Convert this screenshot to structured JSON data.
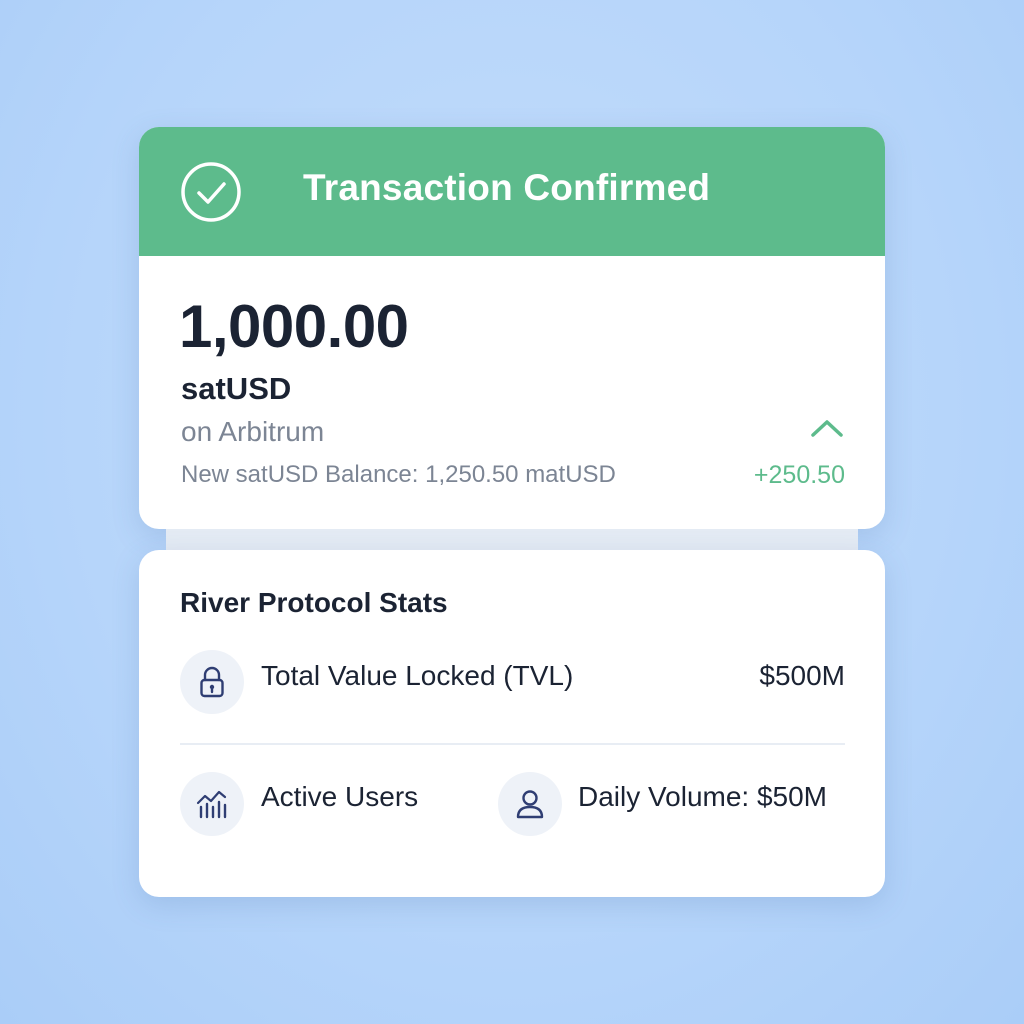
{
  "confirmation": {
    "title": "Transaction Confirmed",
    "amount": "1,000.00",
    "token": "satUSD",
    "network": "on Arbitrum",
    "new_balance": "New satUSD Balance: 1,250.50 matUSD",
    "delta": "+250.50"
  },
  "stats": {
    "title": "River Protocol Stats",
    "tvl_label": "Total Value Locked (TVL)",
    "tvl_value": "$500M",
    "active_users_label": "Active Users",
    "daily_volume_label": "Daily Volume: $50M"
  },
  "icons": {
    "header": "check-circle-icon",
    "toggle": "chevron-up-icon",
    "tvl": "lock-icon",
    "active_users": "chart-icon",
    "daily_volume": "user-icon"
  },
  "colors": {
    "accent_green": "#5dbb8c",
    "text_dark": "#1b2333",
    "text_muted": "#7c8594",
    "icon_navy": "#2f3e73",
    "background": "#b6d5fa"
  }
}
